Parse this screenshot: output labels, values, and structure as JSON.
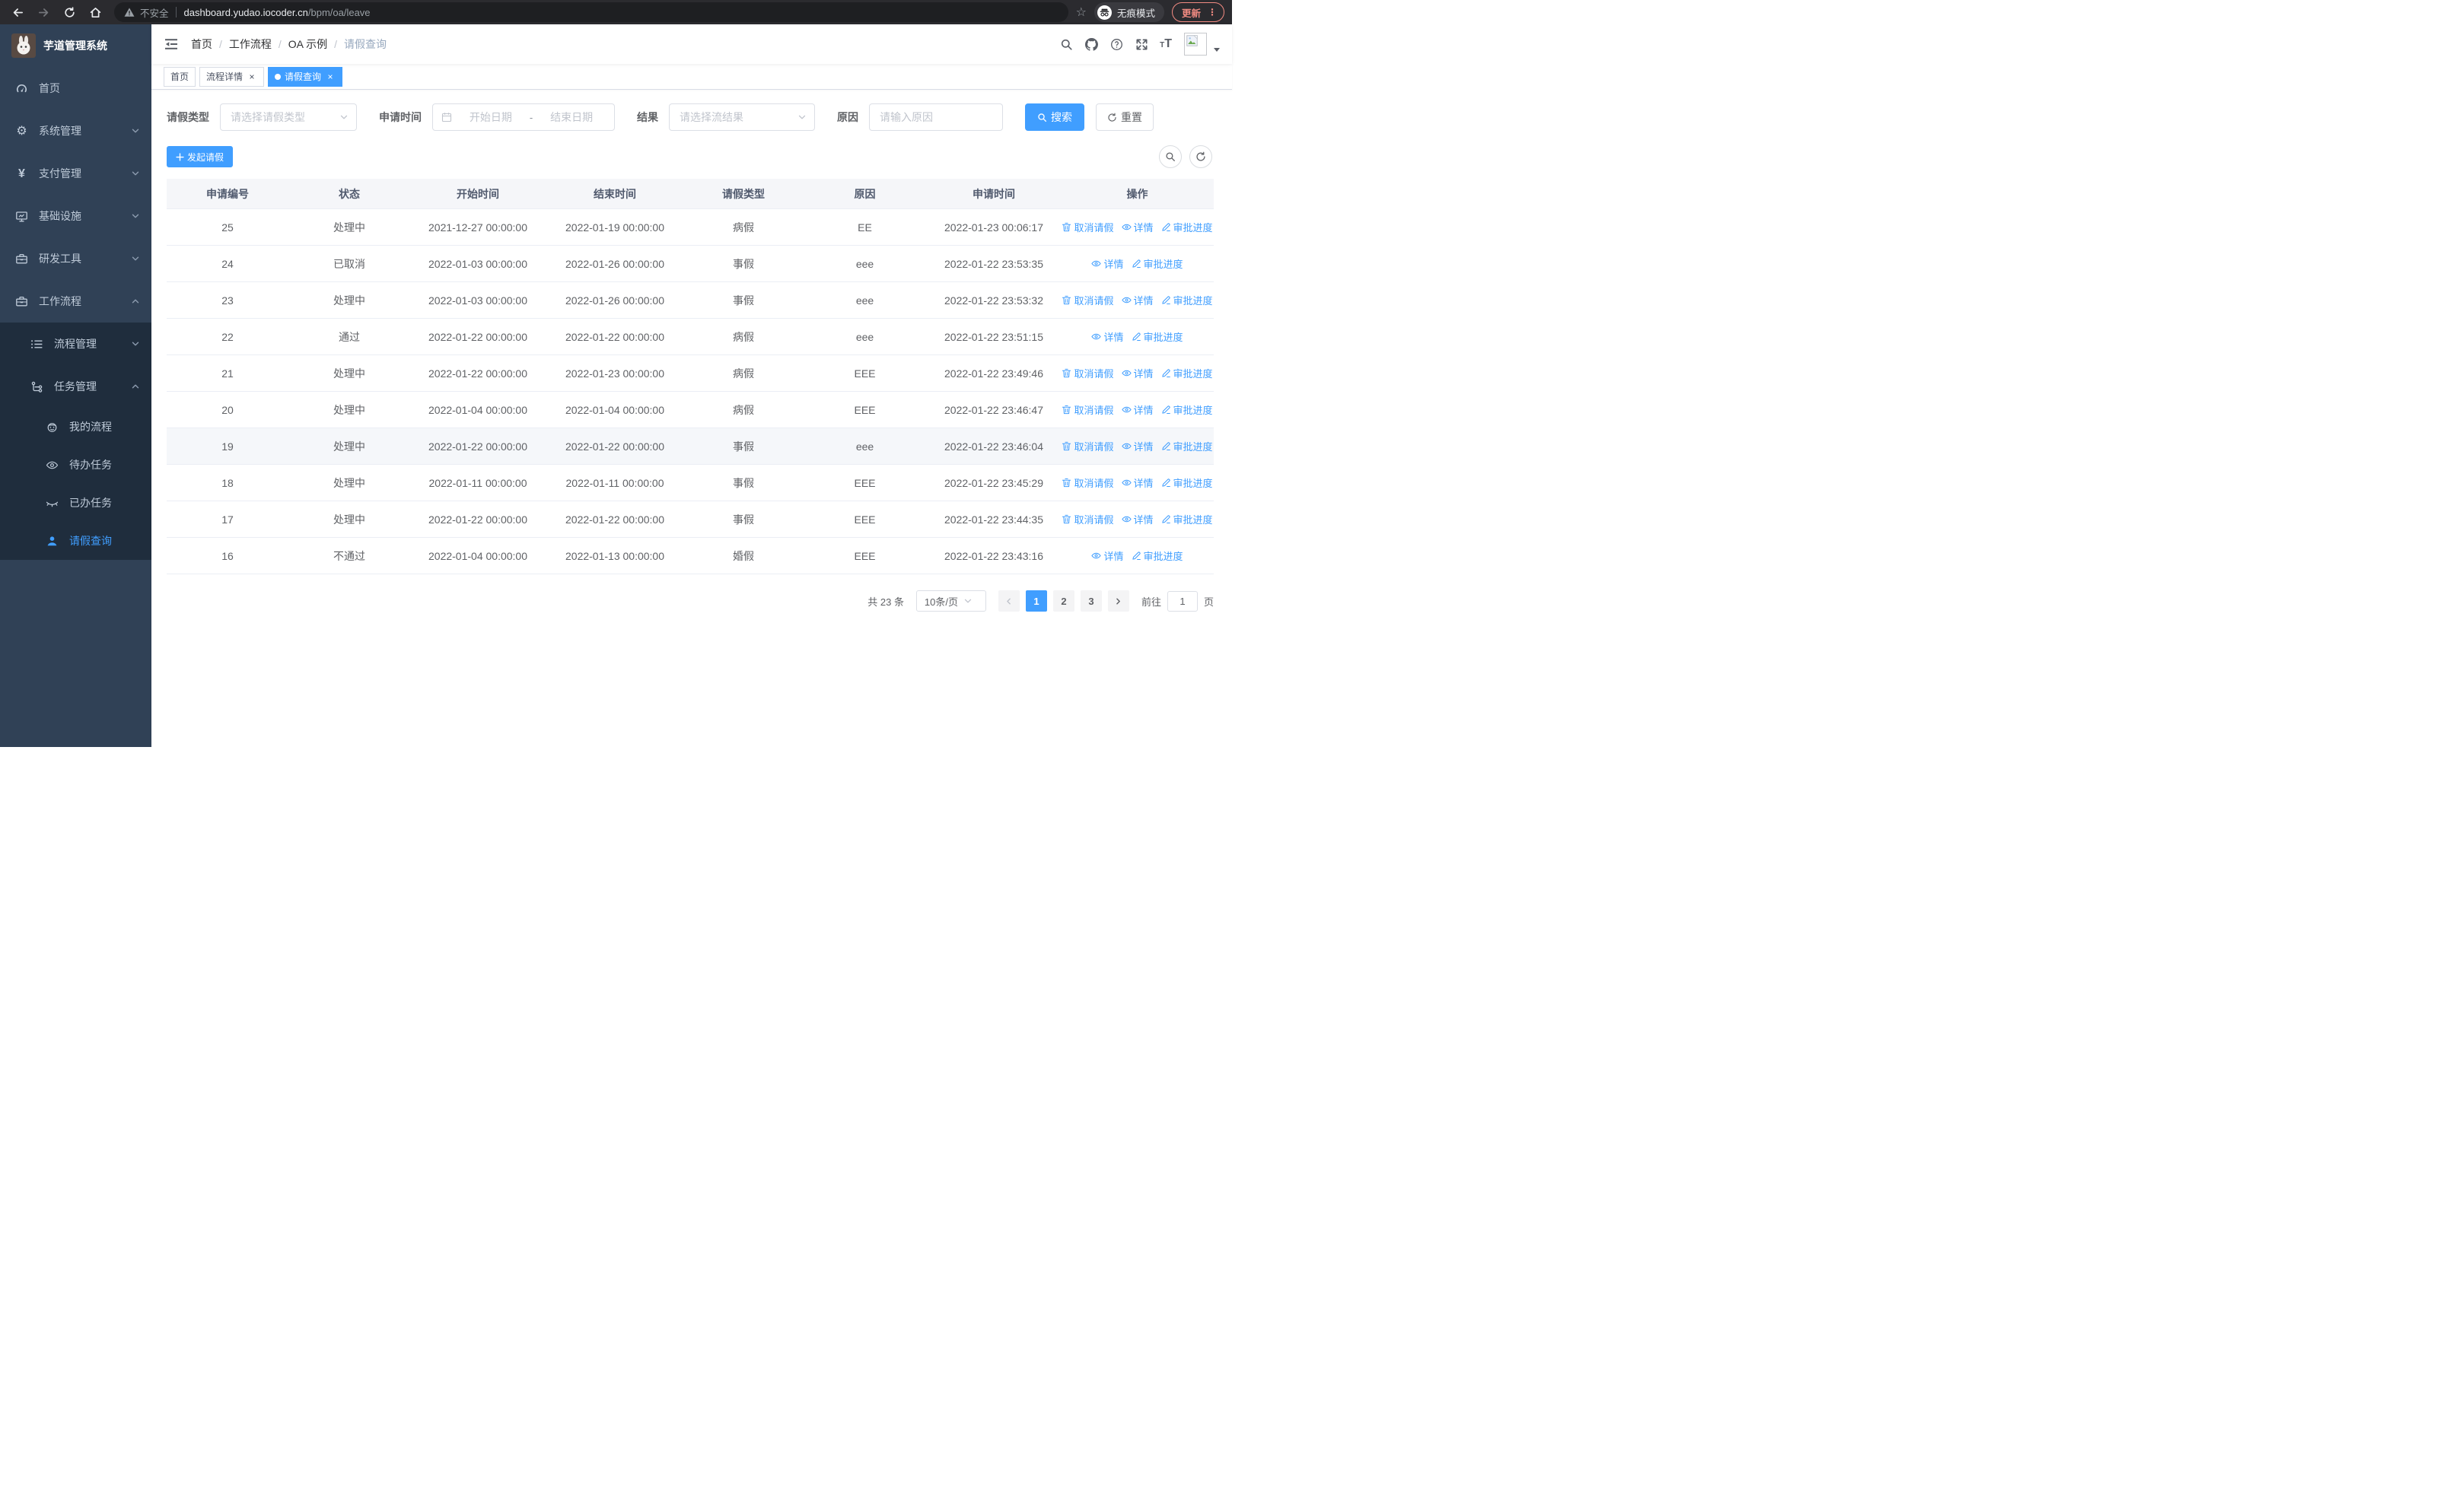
{
  "colors": {
    "primary": "#409eff",
    "sidebar_bg": "#304156",
    "submenu_bg": "#1f2d3d",
    "sidebar_text": "#bfcbd9",
    "update_accent": "#f28b82"
  },
  "browser": {
    "security_label": "不安全",
    "url_host": "dashboard.yudao.iocoder.cn",
    "url_path": "/bpm/oa/leave",
    "incognito_label": "无痕模式",
    "update_label": "更新"
  },
  "sidebar": {
    "title": "芋道管理系统",
    "items": [
      {
        "label": "首页"
      },
      {
        "label": "系统管理"
      },
      {
        "label": "支付管理"
      },
      {
        "label": "基础设施"
      },
      {
        "label": "研发工具"
      },
      {
        "label": "工作流程"
      }
    ],
    "workflow_children": [
      {
        "label": "流程管理"
      },
      {
        "label": "任务管理"
      },
      {
        "label": "我的流程"
      },
      {
        "label": "待办任务"
      },
      {
        "label": "已办任务"
      },
      {
        "label": "请假查询"
      }
    ]
  },
  "navbar": {
    "breadcrumb": [
      "首页",
      "工作流程",
      "OA 示例",
      "请假查询"
    ]
  },
  "tabs": [
    {
      "label": "首页",
      "closable": false,
      "active": false
    },
    {
      "label": "流程详情",
      "closable": true,
      "active": false
    },
    {
      "label": "请假查询",
      "closable": true,
      "active": true
    }
  ],
  "filters": {
    "leave_type_label": "请假类型",
    "leave_type_placeholder": "请选择请假类型",
    "apply_time_label": "申请时间",
    "date_start_placeholder": "开始日期",
    "date_separator": "-",
    "date_end_placeholder": "结束日期",
    "result_label": "结果",
    "result_placeholder": "请选择流结果",
    "reason_label": "原因",
    "reason_placeholder": "请输入原因",
    "search_label": "搜索",
    "reset_label": "重置"
  },
  "toolbar": {
    "create_label": "发起请假"
  },
  "table": {
    "columns": [
      "申请编号",
      "状态",
      "开始时间",
      "结束时间",
      "请假类型",
      "原因",
      "申请时间",
      "操作"
    ],
    "action_labels": {
      "cancel": "取消请假",
      "detail": "详情",
      "progress": "审批进度"
    },
    "rows": [
      {
        "id": "25",
        "status": "处理中",
        "start": "2021-12-27 00:00:00",
        "end": "2022-01-19 00:00:00",
        "type": "病假",
        "reason": "EE",
        "applied": "2022-01-23 00:06:17",
        "actions": [
          "cancel",
          "detail",
          "progress"
        ]
      },
      {
        "id": "24",
        "status": "已取消",
        "start": "2022-01-03 00:00:00",
        "end": "2022-01-26 00:00:00",
        "type": "事假",
        "reason": "eee",
        "applied": "2022-01-22 23:53:35",
        "actions": [
          "detail",
          "progress"
        ]
      },
      {
        "id": "23",
        "status": "处理中",
        "start": "2022-01-03 00:00:00",
        "end": "2022-01-26 00:00:00",
        "type": "事假",
        "reason": "eee",
        "applied": "2022-01-22 23:53:32",
        "actions": [
          "cancel",
          "detail",
          "progress"
        ]
      },
      {
        "id": "22",
        "status": "通过",
        "start": "2022-01-22 00:00:00",
        "end": "2022-01-22 00:00:00",
        "type": "病假",
        "reason": "eee",
        "applied": "2022-01-22 23:51:15",
        "actions": [
          "detail",
          "progress"
        ]
      },
      {
        "id": "21",
        "status": "处理中",
        "start": "2022-01-22 00:00:00",
        "end": "2022-01-23 00:00:00",
        "type": "病假",
        "reason": "EEE",
        "applied": "2022-01-22 23:49:46",
        "actions": [
          "cancel",
          "detail",
          "progress"
        ]
      },
      {
        "id": "20",
        "status": "处理中",
        "start": "2022-01-04 00:00:00",
        "end": "2022-01-04 00:00:00",
        "type": "病假",
        "reason": "EEE",
        "applied": "2022-01-22 23:46:47",
        "actions": [
          "cancel",
          "detail",
          "progress"
        ]
      },
      {
        "id": "19",
        "status": "处理中",
        "start": "2022-01-22 00:00:00",
        "end": "2022-01-22 00:00:00",
        "type": "事假",
        "reason": "eee",
        "applied": "2022-01-22 23:46:04",
        "actions": [
          "cancel",
          "detail",
          "progress"
        ],
        "highlighted": true
      },
      {
        "id": "18",
        "status": "处理中",
        "start": "2022-01-11 00:00:00",
        "end": "2022-01-11 00:00:00",
        "type": "事假",
        "reason": "EEE",
        "applied": "2022-01-22 23:45:29",
        "actions": [
          "cancel",
          "detail",
          "progress"
        ]
      },
      {
        "id": "17",
        "status": "处理中",
        "start": "2022-01-22 00:00:00",
        "end": "2022-01-22 00:00:00",
        "type": "事假",
        "reason": "EEE",
        "applied": "2022-01-22 23:44:35",
        "actions": [
          "cancel",
          "detail",
          "progress"
        ]
      },
      {
        "id": "16",
        "status": "不通过",
        "start": "2022-01-04 00:00:00",
        "end": "2022-01-13 00:00:00",
        "type": "婚假",
        "reason": "EEE",
        "applied": "2022-01-22 23:43:16",
        "actions": [
          "detail",
          "progress"
        ]
      }
    ]
  },
  "pagination": {
    "total_text": "共 23 条",
    "page_size": "10条/页",
    "pages": [
      "1",
      "2",
      "3"
    ],
    "active_page": "1",
    "goto_label": "前往",
    "goto_value": "1",
    "page_suffix": "页"
  }
}
